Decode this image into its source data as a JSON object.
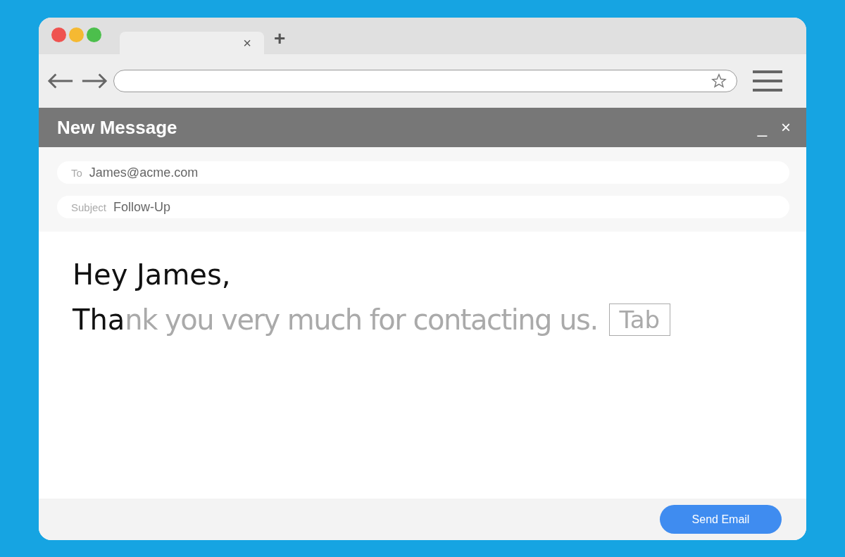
{
  "browser": {
    "tab_close": "×",
    "new_tab": "+"
  },
  "compose": {
    "title": "New Message",
    "minimize": "_",
    "close": "×",
    "fields": [
      {
        "label": "To",
        "value": "James@acme.com"
      },
      {
        "label": "Subject",
        "value": "Follow-Up"
      }
    ],
    "greeting": "Hey James,",
    "typed": "Tha",
    "suggestion": "nk you very much for contacting us.",
    "key_hint": "Tab",
    "send_button": "Send Email"
  }
}
